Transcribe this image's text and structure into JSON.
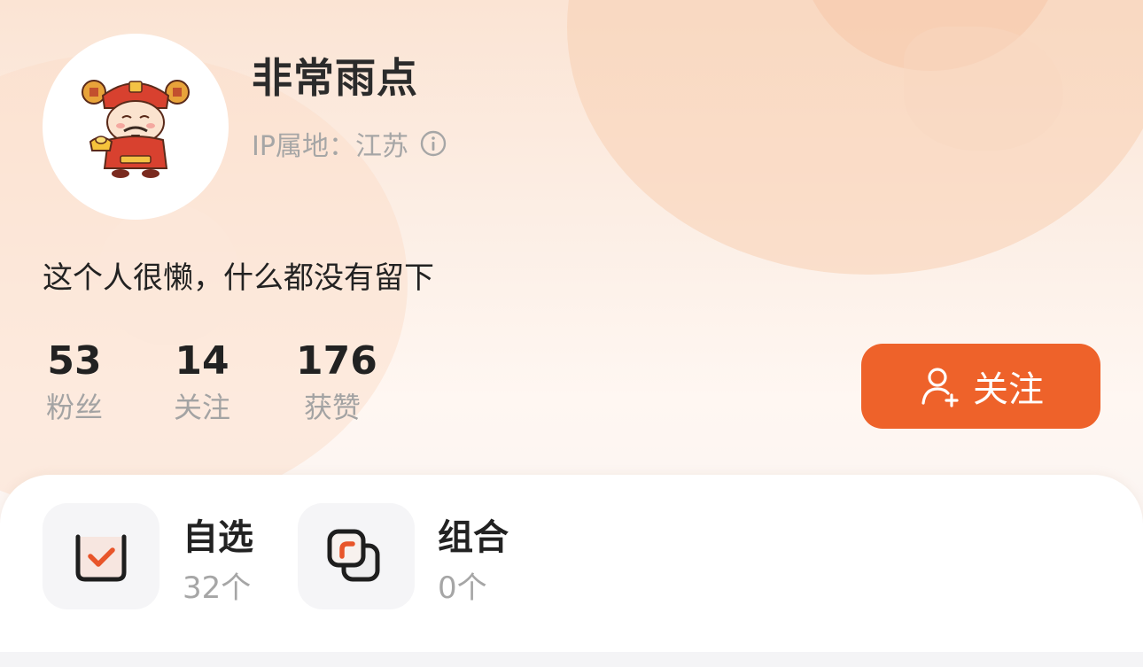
{
  "profile": {
    "username": "非常雨点",
    "ip_location": "IP属地：江苏",
    "bio": "这个人很懒，什么都没有留下",
    "avatar_icon": "god-of-wealth-avatar"
  },
  "stats": [
    {
      "value": "53",
      "label": "粉丝"
    },
    {
      "value": "14",
      "label": "关注"
    },
    {
      "value": "176",
      "label": "获赞"
    }
  ],
  "follow_button": {
    "label": "关注",
    "icon": "add-user-icon",
    "color": "#ee622a"
  },
  "entries": [
    {
      "title": "自选",
      "count": "32个",
      "icon": "checkmark-box-icon"
    },
    {
      "title": "组合",
      "count": "0个",
      "icon": "stacked-squares-icon"
    }
  ],
  "colors": {
    "accent": "#ee622a",
    "text_primary": "#222222",
    "text_secondary": "#a6a6a6"
  }
}
